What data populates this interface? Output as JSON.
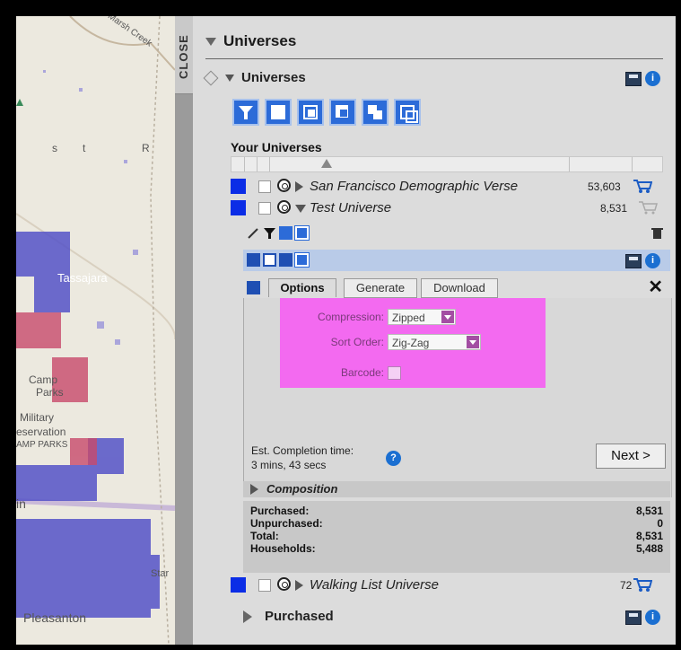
{
  "map": {
    "labels": [
      "Tassajara",
      "Camp",
      "Parks",
      "Military",
      "eservation",
      "AMP PARKS",
      "Pleasanton",
      "in",
      "Star",
      "s",
      "t",
      "R",
      "Marsh Creek"
    ]
  },
  "close_tab": "CLOSE",
  "header": {
    "title": "Universes"
  },
  "subheader": {
    "title": "Universes"
  },
  "your_universes": {
    "label": "Your Universes",
    "rows": [
      {
        "name": "San Francisco Demographic Verse",
        "count": "53,603",
        "color": "#0b2de6",
        "expanded": false
      },
      {
        "name": "Test Universe",
        "count": "8,531",
        "color": "#0b2de6",
        "expanded": true
      },
      {
        "name": "Walking List Universe",
        "count": "72",
        "color": "#0b2de6",
        "expanded": false
      }
    ]
  },
  "tabs": {
    "options": "Options",
    "generate": "Generate",
    "download": "Download"
  },
  "options_form": {
    "compression_label": "Compression:",
    "compression_value": "Zipped",
    "sort_label": "Sort Order:",
    "sort_value": "Zig-Zag",
    "barcode_label": "Barcode:"
  },
  "estimate": {
    "label": "Est. Completion time:",
    "value": "3 mins, 43 secs"
  },
  "next_button": "Next >",
  "composition": {
    "title": "Composition",
    "rows": [
      {
        "label": "Purchased:",
        "value": "8,531"
      },
      {
        "label": "Unpurchased:",
        "value": "0"
      },
      {
        "label": "Total:",
        "value": "8,531"
      },
      {
        "label": "Households:",
        "value": "5,488"
      }
    ]
  },
  "purchased": {
    "title": "Purchased"
  },
  "colors": {
    "accent_blue": "#2c6bd8",
    "highlight_magenta": "#f36af0",
    "selection_bar": "#b9cbe8"
  }
}
